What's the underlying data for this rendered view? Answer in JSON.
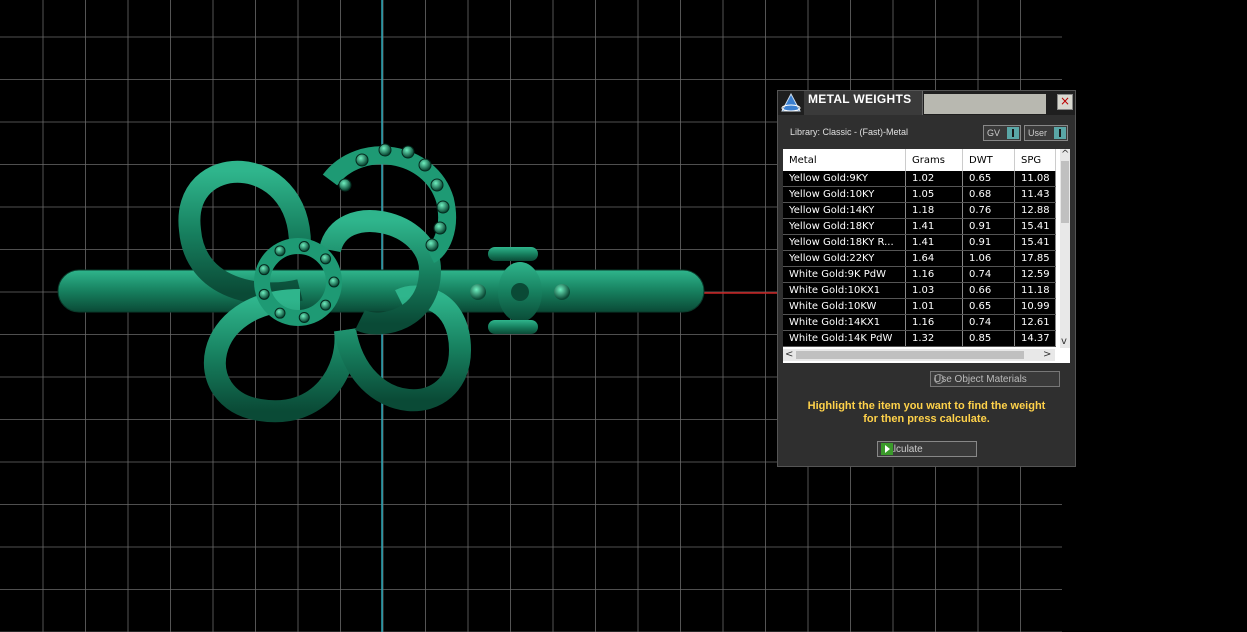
{
  "panel": {
    "title": "METAL WEIGHTS",
    "library_label": "Library: Classic - (Fast)-Metal",
    "gv_label": "GV",
    "user_label": "User",
    "close_label": "×",
    "columns": [
      "Metal",
      "Grams",
      "DWT",
      "SPG"
    ],
    "rows": [
      [
        "Yellow Gold:9KY",
        "1.02",
        "0.65",
        "11.08"
      ],
      [
        "Yellow Gold:10KY",
        "1.05",
        "0.68",
        "11.43"
      ],
      [
        "Yellow Gold:14KY",
        "1.18",
        "0.76",
        "12.88"
      ],
      [
        "Yellow Gold:18KY",
        "1.41",
        "0.91",
        "15.41"
      ],
      [
        "Yellow Gold:18KY R...",
        "1.41",
        "0.91",
        "15.41"
      ],
      [
        "Yellow Gold:22KY",
        "1.64",
        "1.06",
        "17.85"
      ],
      [
        "White Gold:9K PdW",
        "1.16",
        "0.74",
        "12.59"
      ],
      [
        "White Gold:10KX1",
        "1.03",
        "0.66",
        "11.18"
      ],
      [
        "White Gold:10KW",
        "1.01",
        "0.65",
        "10.99"
      ],
      [
        "White Gold:14KX1",
        "1.16",
        "0.74",
        "12.61"
      ],
      [
        "White Gold:14K PdW",
        "1.32",
        "0.85",
        "14.37"
      ]
    ],
    "use_object_materials": "Use Object Materials",
    "hint_line1": "Highlight the item you want to find the weight",
    "hint_line2": "for then press calculate.",
    "calculate_label": "Calculate"
  },
  "colors": {
    "model": "#1f8f6f",
    "grid": "#6a6a6a",
    "axis_y": "#2aa8b8",
    "axis_x": "#cc2222",
    "hint": "#ffd24a"
  },
  "icons": [
    "app-logo-icon",
    "close-icon",
    "toggle-icon",
    "gear-icon",
    "play-icon",
    "scroll-up-icon",
    "scroll-down-icon",
    "scroll-left-icon",
    "scroll-right-icon"
  ]
}
